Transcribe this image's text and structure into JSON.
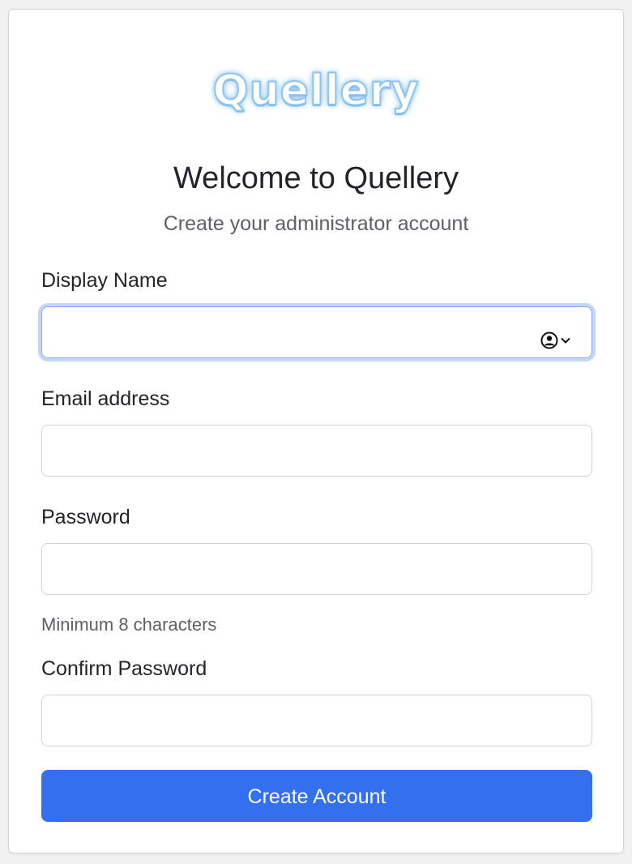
{
  "brand": {
    "logo_text": "Quellery"
  },
  "header": {
    "title": "Welcome to Quellery",
    "subtitle": "Create your administrator account"
  },
  "form": {
    "display_name": {
      "label": "Display Name",
      "value": "",
      "autofill_icon": "contact-autofill-icon"
    },
    "email": {
      "label": "Email address",
      "value": ""
    },
    "password": {
      "label": "Password",
      "value": "",
      "help": "Minimum 8 characters"
    },
    "confirm_password": {
      "label": "Confirm Password",
      "value": ""
    },
    "submit_label": "Create Account"
  },
  "colors": {
    "primary": "#3370ef",
    "focus_ring": "#c6d6f8",
    "logo_glow": "#7fbdf0"
  }
}
